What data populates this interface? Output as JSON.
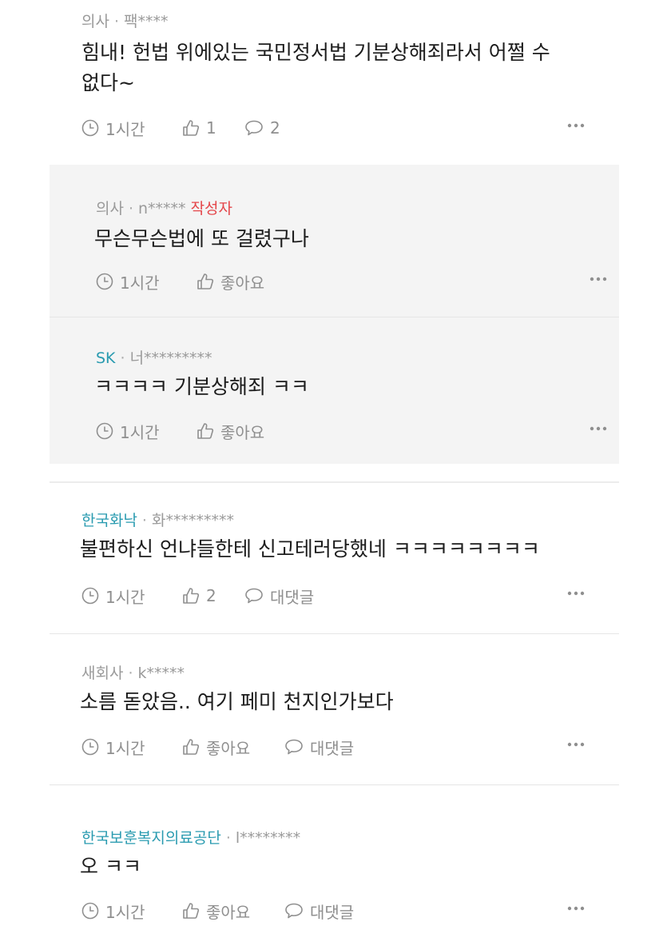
{
  "comments": [
    {
      "company": "의사",
      "user": "팩****",
      "text": [
        "힘내! 헌법 위에있는 국민정서법 기분상해죄라서 어쩔 수",
        "없다~"
      ],
      "time": "1시간",
      "likes": "1",
      "replies": "2"
    },
    {
      "company": "한국화낙",
      "user": "화*********",
      "text": [
        "불편하신 언냐들한테 신고테러당했네 ㅋㅋㅋㅋㅋㅋㅋㅋ"
      ],
      "time": "1시간",
      "likes": "2",
      "replies": "대댓글"
    },
    {
      "company": "새회사",
      "user": "k*****",
      "text": [
        "소름 돋았음.. 여기 페미 천지인가보다"
      ],
      "time": "1시간",
      "likes": "좋아요",
      "replies": "대댓글"
    },
    {
      "company": "한국보훈복지의료공단",
      "user": "l********",
      "text": [
        "오 ㅋㅋ"
      ],
      "time": "1시간",
      "likes": "좋아요",
      "replies": "대댓글"
    }
  ],
  "replies": [
    {
      "company": "의사",
      "user": "n*****",
      "author_tag": "작성자",
      "text": "무슨무슨법에 또 걸렸구나",
      "time": "1시간",
      "likes": "좋아요"
    },
    {
      "company": "SK",
      "user": "너*********",
      "text": "ㅋㅋㅋㅋ 기분상해죄 ㅋㅋ",
      "time": "1시간",
      "likes": "좋아요"
    }
  ],
  "colors": {
    "company_blue": "#2a9bb0",
    "author_tag_red": "#e4464a",
    "meta_gray": "#9a9a9a",
    "reply_bg": "#f4f4f4"
  },
  "icons": {
    "time": "clock-icon",
    "like": "thumbs-up-icon",
    "reply": "speech-bubble-icon",
    "more": "more-dots-icon"
  }
}
